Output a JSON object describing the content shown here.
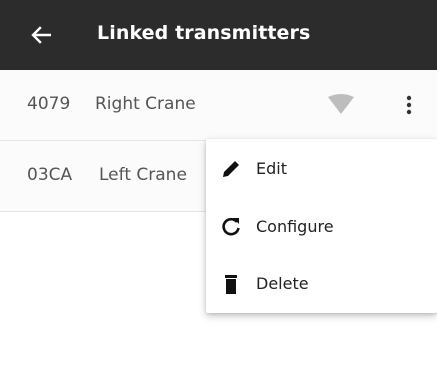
{
  "appbar": {
    "title": "Linked transmitters",
    "back_icon": "arrow-left-icon",
    "background": "#2c2c2c"
  },
  "transmitters": [
    {
      "id": "4079",
      "name": "Right Crane"
    },
    {
      "id": "03CA",
      "name": "Left Crane"
    }
  ],
  "row_icons": {
    "signal": "wifi-signal-icon",
    "more": "more-vert-icon"
  },
  "context_menu": {
    "items": [
      {
        "label": "Edit",
        "icon": "pencil-icon"
      },
      {
        "label": "Configure",
        "icon": "refresh-icon"
      },
      {
        "label": "Delete",
        "icon": "trash-icon"
      }
    ]
  }
}
